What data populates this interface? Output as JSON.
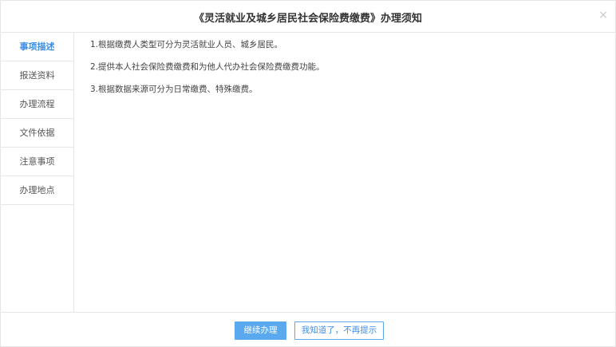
{
  "dialog": {
    "title": "《灵活就业及城乡居民社会保险费缴费》办理须知",
    "close_icon": "×"
  },
  "sidebar": {
    "items": [
      {
        "label": "事项描述",
        "active": true
      },
      {
        "label": "报送资料",
        "active": false
      },
      {
        "label": "办理流程",
        "active": false
      },
      {
        "label": "文件依据",
        "active": false
      },
      {
        "label": "注意事项",
        "active": false
      },
      {
        "label": "办理地点",
        "active": false
      }
    ]
  },
  "content": {
    "lines": [
      "1.根据缴费人类型可分为灵活就业人员、城乡居民。",
      "2.提供本人社会保险费缴费和为他人代办社会保险费缴费功能。",
      "3.根据数据来源可分为日常缴费、特殊缴费。"
    ]
  },
  "footer": {
    "continue_label": "继续办理",
    "dismiss_label": "我知道了，不再提示"
  },
  "colors": {
    "accent": "#3d8ee5",
    "primary_button": "#5aa8ee",
    "border": "#e6e6e6"
  }
}
